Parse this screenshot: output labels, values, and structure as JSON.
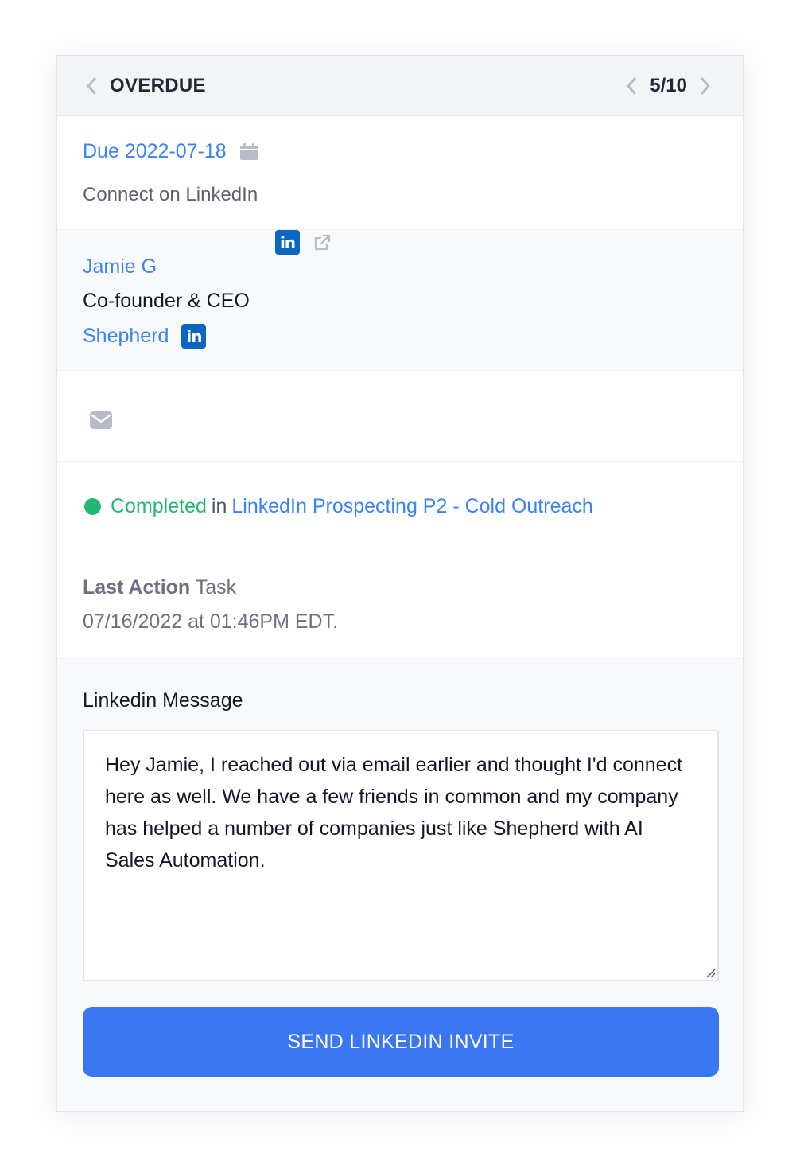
{
  "header": {
    "title": "OVERDUE",
    "pager_count": "5/10"
  },
  "task": {
    "due": "Due 2022-07-18",
    "type": "Connect on LinkedIn"
  },
  "contact": {
    "name": "Jamie G",
    "title": "Co-founder & CEO",
    "company": "Shepherd",
    "linkedin_badge": "in",
    "company_linkedin_badge": "in"
  },
  "status": {
    "label": "Completed",
    "connector": "in",
    "sequence": "LinkedIn Prospecting P2 - Cold Outreach",
    "color": "#22b573"
  },
  "last_action": {
    "label": "Last Action",
    "value": "Task",
    "timestamp": "07/16/2022 at 01:46PM EDT."
  },
  "message": {
    "label": "Linkedin Message",
    "body": "Hey Jamie, I reached out via email earlier and thought I'd connect here as well. We have a few friends in common and my company has helped a number of companies just like Shepherd with AI Sales Automation."
  },
  "actions": {
    "send_label": "SEND LINKEDIN INVITE"
  },
  "colors": {
    "accent": "#3b77f2",
    "link": "#3b82f6",
    "linkedin": "#0a66c2"
  },
  "icons": {
    "prev": "chevron-left-icon",
    "next": "chevron-right-icon",
    "calendar": "calendar-icon",
    "linkedin": "linkedin-icon",
    "external": "external-link-icon",
    "mail": "mail-icon",
    "resize": "resize-handle-icon"
  }
}
